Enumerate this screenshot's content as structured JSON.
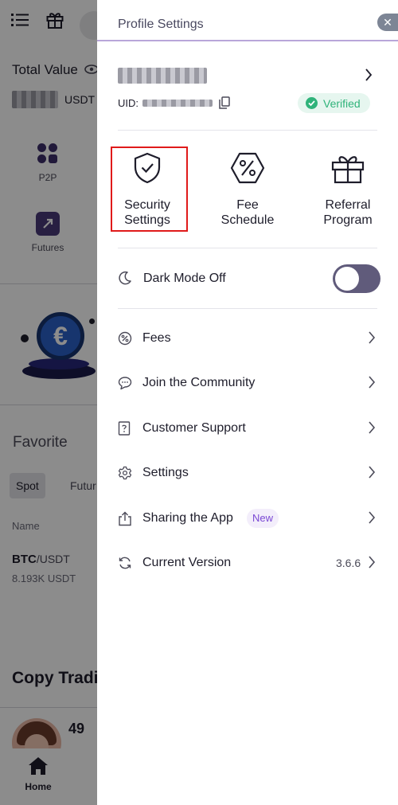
{
  "background": {
    "total_value_label": "Total Value",
    "balance_unit": "USDT",
    "shortcuts": [
      "P2P",
      "Futures"
    ],
    "favorite_title": "Favorite",
    "tabs": [
      "Spot",
      "Futur"
    ],
    "name_column": "Name",
    "pair_base": "BTC",
    "pair_quote": "/USDT",
    "pair_volume": "8.193K USDT",
    "copy_trading_title": "Copy Tradi",
    "trader_number": "49",
    "bottom_nav_home": "Home",
    "coin_symbol": "€"
  },
  "drawer": {
    "title": "Profile Settings",
    "close_symbol": "✕",
    "uid_label": "UID:",
    "verified_label": "Verified",
    "quick_actions": [
      {
        "label_line1": "Security",
        "label_line2": "Settings",
        "icon": "shield-check-icon"
      },
      {
        "label_line1": "Fee",
        "label_line2": "Schedule",
        "icon": "percent-hexagon-icon"
      },
      {
        "label_line1": "Referral",
        "label_line2": "Program",
        "icon": "gift-icon"
      }
    ],
    "dark_mode_label": "Dark Mode Off",
    "dark_mode_on": false,
    "menu": [
      {
        "label": "Fees",
        "icon": "percent-circle-icon"
      },
      {
        "label": "Join the Community",
        "icon": "chat-bubble-icon"
      },
      {
        "label": "Customer Support",
        "icon": "help-icon"
      },
      {
        "label": "Settings",
        "icon": "gear-icon"
      },
      {
        "label": "Sharing the App",
        "icon": "share-icon",
        "badge": "New"
      },
      {
        "label": "Current Version",
        "icon": "refresh-icon",
        "value": "3.6.6"
      }
    ]
  },
  "colors": {
    "accent_purple": "#7a48d4",
    "verified_green": "#2fb37a",
    "highlight_red": "#e01a1a",
    "toggle_track": "#605b7b"
  }
}
